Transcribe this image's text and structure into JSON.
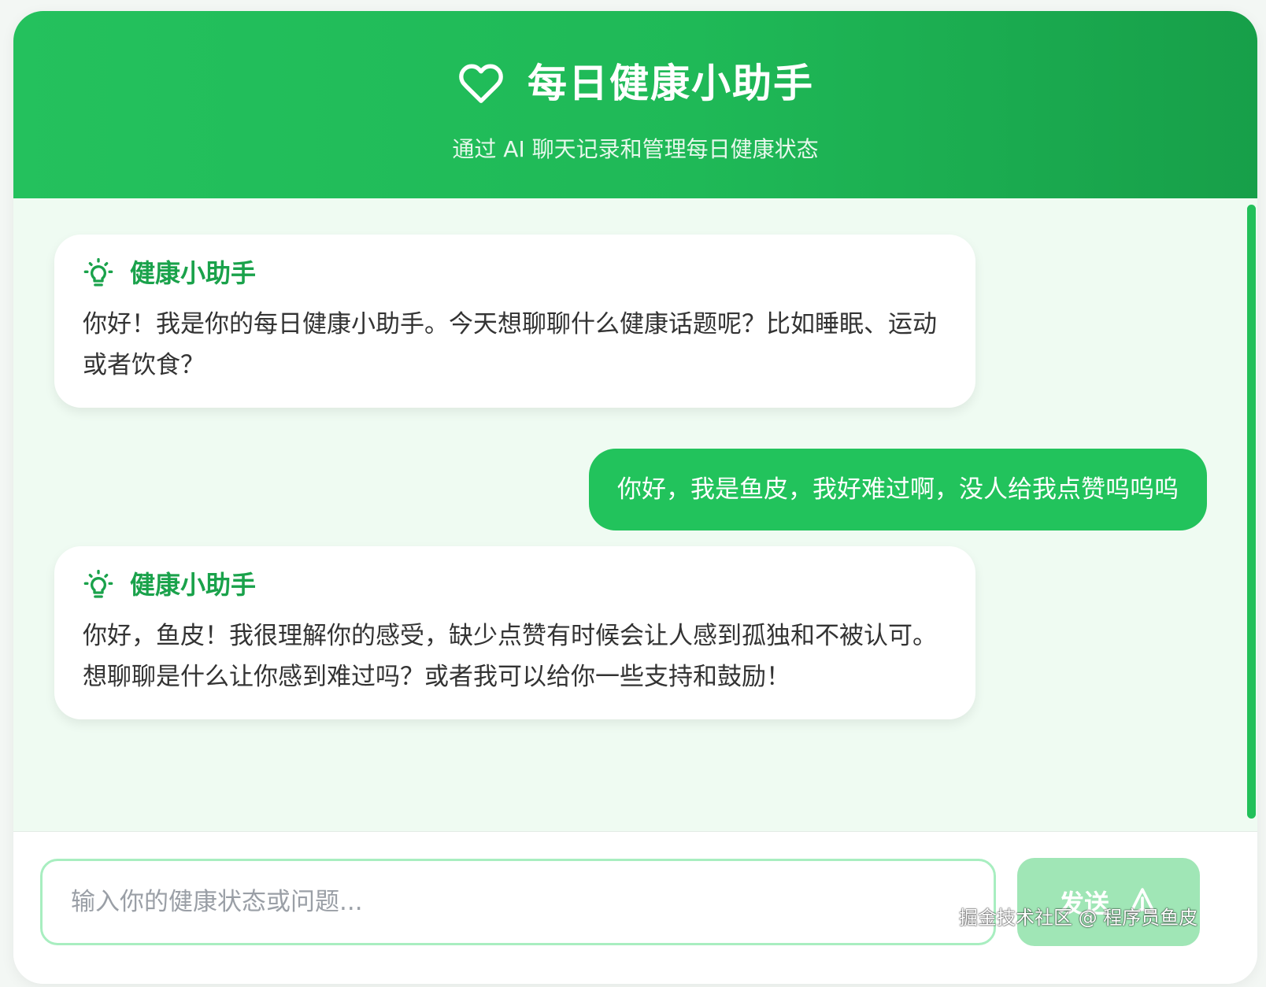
{
  "header": {
    "icon": "heart-icon",
    "title": "每日健康小助手",
    "subtitle": "通过 AI 聊天记录和管理每日健康状态"
  },
  "messages": [
    {
      "role": "bot",
      "icon": "lightbulb-icon",
      "name": "健康小助手",
      "text": "你好！我是你的每日健康小助手。今天想聊聊什么健康话题呢？比如睡眠、运动或者饮食？"
    },
    {
      "role": "user",
      "text": "你好，我是鱼皮，我好难过啊，没人给我点赞呜呜呜"
    },
    {
      "role": "bot",
      "icon": "lightbulb-icon",
      "name": "健康小助手",
      "text": "你好，鱼皮！我很理解你的感受，缺少点赞有时候会让人感到孤独和不被认可。想聊聊是什么让你感到难过吗？或者我可以给你一些支持和鼓励！"
    }
  ],
  "input": {
    "placeholder": "输入你的健康状态或问题...",
    "value": ""
  },
  "send_button": {
    "label": "发送",
    "icon": "send-icon"
  },
  "watermark": "掘金技术社区 @ 程序员鱼皮",
  "colors": {
    "primary": "#22c35c",
    "header_dark": "#179f49",
    "bot_name": "#1aa24b",
    "chat_bg": "#effbf2",
    "send_disabled": "#a0e6b6",
    "input_border": "#a8eec0"
  }
}
